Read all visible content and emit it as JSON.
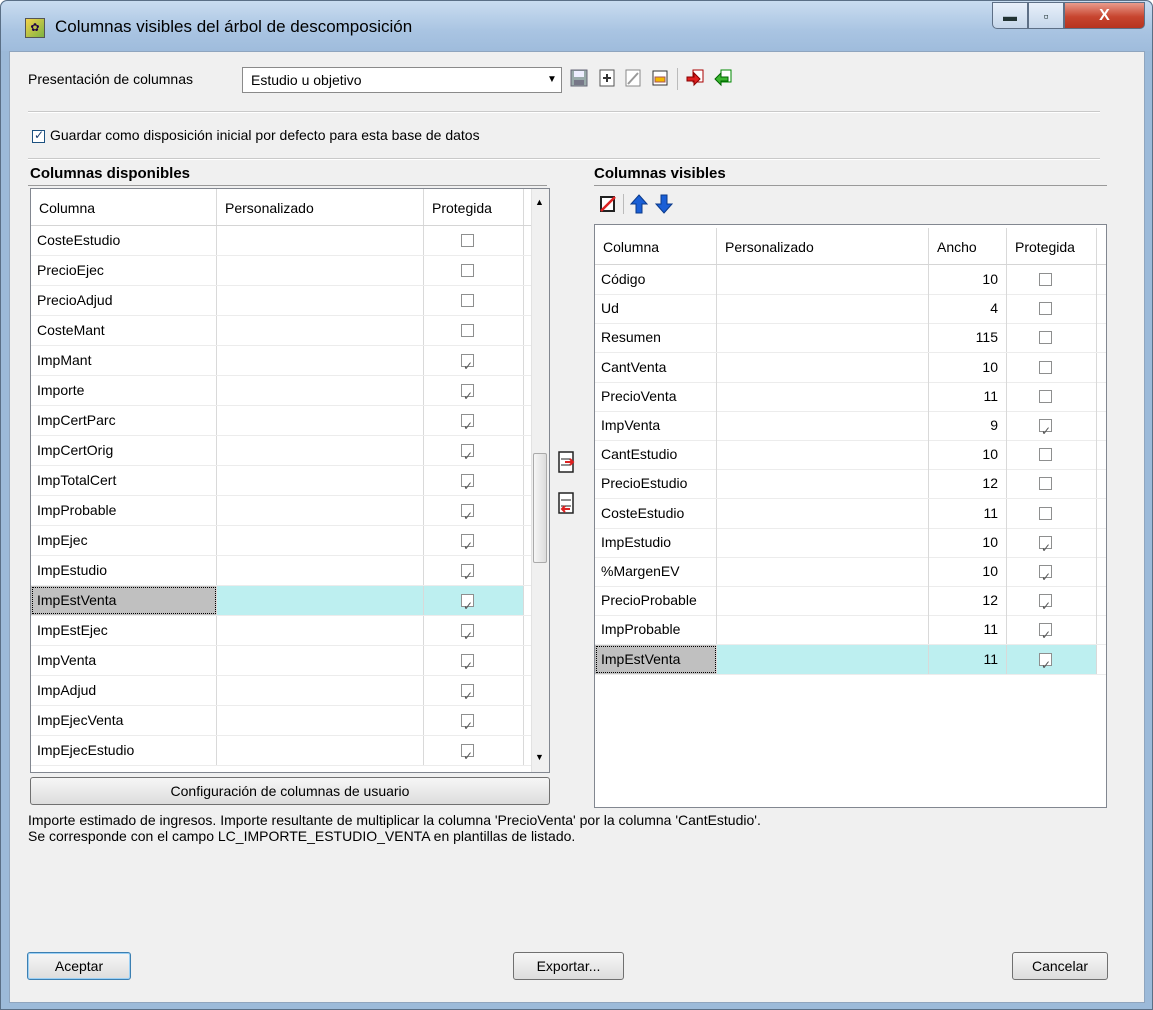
{
  "window": {
    "title": "Columnas visibles del árbol de descomposición",
    "close_glyph": "X",
    "max_glyph": "▫",
    "min_glyph": "▬"
  },
  "presentacion": {
    "label": "Presentación de columnas",
    "value": "Estudio u objetivo",
    "toolbar_icons": [
      "save-icon",
      "new-icon",
      "edit-icon",
      "rename-icon",
      "import-icon",
      "export-icon"
    ]
  },
  "default_checkbox": {
    "label": "Guardar como disposición inicial por defecto para esta base de datos",
    "checked": true
  },
  "available": {
    "title": "Columnas disponibles",
    "headers": [
      "Columna",
      "Personalizado",
      "Protegida"
    ],
    "rows": [
      {
        "name": "CosteEstudio",
        "custom": "",
        "protected": false
      },
      {
        "name": "PrecioEjec",
        "custom": "",
        "protected": false
      },
      {
        "name": "PrecioAdjud",
        "custom": "",
        "protected": false
      },
      {
        "name": "CosteMant",
        "custom": "",
        "protected": false
      },
      {
        "name": "ImpMant",
        "custom": "",
        "protected": true
      },
      {
        "name": "Importe",
        "custom": "",
        "protected": true
      },
      {
        "name": "ImpCertParc",
        "custom": "",
        "protected": true
      },
      {
        "name": "ImpCertOrig",
        "custom": "",
        "protected": true
      },
      {
        "name": "ImpTotalCert",
        "custom": "",
        "protected": true
      },
      {
        "name": "ImpProbable",
        "custom": "",
        "protected": true
      },
      {
        "name": "ImpEjec",
        "custom": "",
        "protected": true
      },
      {
        "name": "ImpEstudio",
        "custom": "",
        "protected": true
      },
      {
        "name": "ImpEstVenta",
        "custom": "",
        "protected": true,
        "selected": true
      },
      {
        "name": "ImpEstEjec",
        "custom": "",
        "protected": true
      },
      {
        "name": "ImpVenta",
        "custom": "",
        "protected": true
      },
      {
        "name": "ImpAdjud",
        "custom": "",
        "protected": true
      },
      {
        "name": "ImpEjecVenta",
        "custom": "",
        "protected": true
      },
      {
        "name": "ImpEjecEstudio",
        "custom": "",
        "protected": true
      }
    ],
    "config_button": "Configuración de columnas de usuario"
  },
  "visible": {
    "title": "Columnas visibles",
    "headers": [
      "Columna",
      "Personalizado",
      "Ancho",
      "Protegida"
    ],
    "rows": [
      {
        "name": "Código",
        "custom": "",
        "width": "10",
        "protected": false
      },
      {
        "name": "Ud",
        "custom": "",
        "width": "4",
        "protected": false
      },
      {
        "name": "Resumen",
        "custom": "",
        "width": "115",
        "protected": false
      },
      {
        "name": "CantVenta",
        "custom": "",
        "width": "10",
        "protected": false
      },
      {
        "name": "PrecioVenta",
        "custom": "",
        "width": "11",
        "protected": false
      },
      {
        "name": "ImpVenta",
        "custom": "",
        "width": "9",
        "protected": true
      },
      {
        "name": "CantEstudio",
        "custom": "",
        "width": "10",
        "protected": false
      },
      {
        "name": "PrecioEstudio",
        "custom": "",
        "width": "12",
        "protected": false
      },
      {
        "name": "CosteEstudio",
        "custom": "",
        "width": "11",
        "protected": false
      },
      {
        "name": "ImpEstudio",
        "custom": "",
        "width": "10",
        "protected": true
      },
      {
        "name": "%MargenEV",
        "custom": "",
        "width": "10",
        "protected": true
      },
      {
        "name": "PrecioProbable",
        "custom": "",
        "width": "12",
        "protected": true
      },
      {
        "name": "ImpProbable",
        "custom": "",
        "width": "11",
        "protected": true
      },
      {
        "name": "ImpEstVenta",
        "custom": "",
        "width": "11",
        "protected": true,
        "selected": true
      }
    ]
  },
  "description": {
    "line1": "Importe estimado de ingresos. Importe resultante de multiplicar la columna 'PrecioVenta' por la columna 'CantEstudio'.",
    "line2": "Se corresponde con el campo LC_IMPORTE_ESTUDIO_VENTA en plantillas de listado."
  },
  "buttons": {
    "accept": "Aceptar",
    "export": "Exportar...",
    "cancel": "Cancelar"
  },
  "colors": {
    "selection_teal": "#bdeff0",
    "selection_gray": "#c0c0c0",
    "arrow_blue": "#1a5fd6"
  }
}
